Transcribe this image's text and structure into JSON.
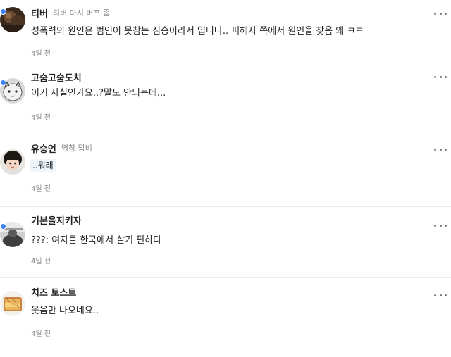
{
  "comments": [
    {
      "nickname": "티버",
      "badge": "티버 다시 버프 좀",
      "text": "성폭력의 원인은 범인이 못참는 짐승이라서 입니다.. 피해자 쪽에서 원인을 찾음 왜 ㅋㅋ",
      "time": "4일 전",
      "avatar_icon": "dark-brown-photo-avatar",
      "has_dot": true
    },
    {
      "nickname": "고숨고숨도치",
      "badge": "",
      "text": "이거 사실인가요..?말도 안되는데...",
      "time": "4일 전",
      "avatar_icon": "sketch-character-avatar",
      "has_dot": true
    },
    {
      "nickname": "유승언",
      "badge": "명창 답비",
      "text": "..뭐래",
      "time": "4일 전",
      "avatar_icon": "child-portrait-avatar",
      "has_dot": false
    },
    {
      "nickname": "기본을지키자",
      "badge": "",
      "text": "???: 여자들 한국에서 살기 편하다",
      "time": "4일 전",
      "avatar_icon": "grey-silhouette-avatar",
      "has_dot": true
    },
    {
      "nickname": "치즈 토스트",
      "badge": "",
      "text": "웃음만 나오네요..",
      "time": "4일 전",
      "avatar_icon": "cheese-toast-avatar",
      "has_dot": false
    }
  ],
  "colors": {
    "dot": "#3b82f6",
    "muted": "#8a8a8a",
    "text": "#222222",
    "divider": "#ececec",
    "highlight_bg": "#eef6fb"
  }
}
